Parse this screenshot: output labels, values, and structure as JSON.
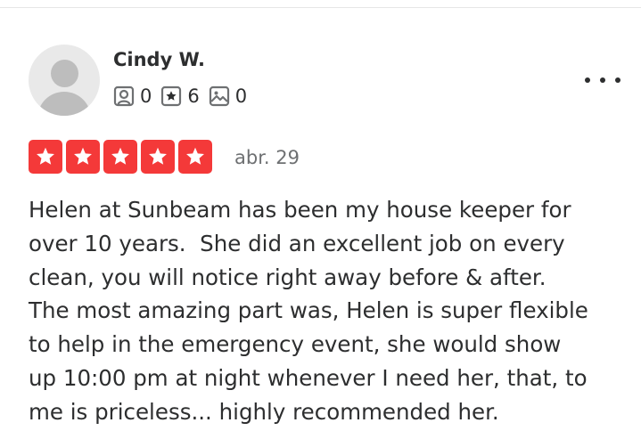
{
  "reviewer": {
    "name": "Cindy W.",
    "avatar_icon": "default-user-avatar",
    "stats": {
      "friends": "0",
      "reviews": "6",
      "photos": "0"
    }
  },
  "more_icon": "ellipsis-icon",
  "rating": {
    "stars": 5,
    "max": 5,
    "color": "#f43939"
  },
  "date": "abr. 29",
  "review_lines": [
    "Helen at Sunbeam has been my house keeper for",
    "over 10 years.  She did an excellent job on every",
    "clean, you will notice right away before & after.",
    "The most amazing part was, Helen is super flexible",
    "to help in the emergency event, she would show",
    "up 10:00 pm at night whenever I need her, that, to",
    "me is priceless... highly recommended her."
  ]
}
